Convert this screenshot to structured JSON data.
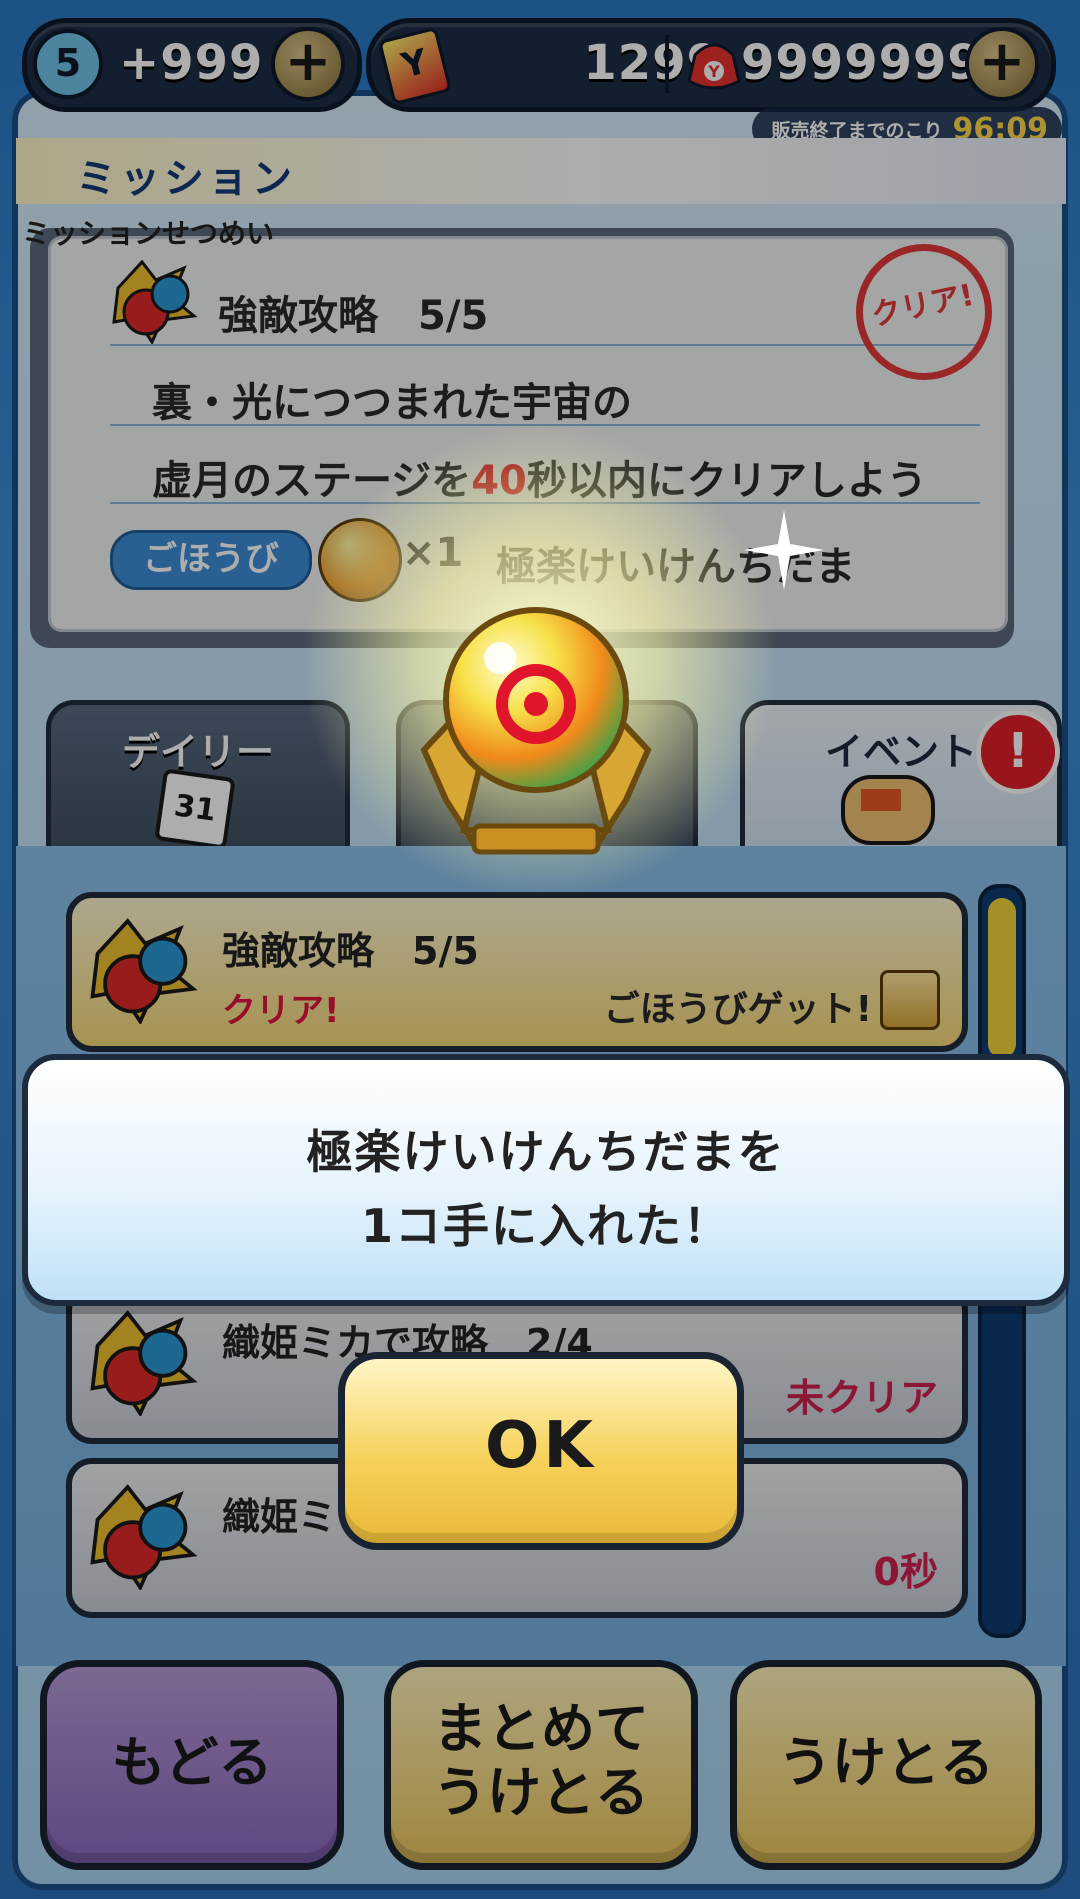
{
  "topbar": {
    "lives_count": "5",
    "lives_value": "+999",
    "tickets": "1299",
    "money": "9999999",
    "sale_label": "販売終了までのこり",
    "sale_timer": "96:09"
  },
  "mission_header": {
    "title": "ミッション"
  },
  "description": {
    "section_label": "ミッションせつめい",
    "mission_name": "強敵攻略　5/5",
    "line1": "裏・光につつまれた宇宙の",
    "line2_pre": "虚月のステージを",
    "line2_num": "40",
    "line2_post": "秒以内にクリアしよう",
    "reward_label": "ごほうび",
    "reward_qty": "×1",
    "reward_name": "極楽けいけんちだま",
    "clear_stamp": "クリア!"
  },
  "tabs": [
    {
      "label": "デイリー",
      "icon": "calendar-icon",
      "icon_text": "31"
    },
    {
      "label": "",
      "icon": ""
    },
    {
      "label": "イベント",
      "icon": "flag-icon"
    }
  ],
  "alert_badge": "!",
  "missions": [
    {
      "name": "強敵攻略　5/5",
      "clear": "クリア!",
      "get": "ごほうびゲット!"
    },
    {
      "name": "織姫ミカで攻略　2/4",
      "status": "未クリア"
    },
    {
      "name": "織姫ミ",
      "status": "0秒"
    }
  ],
  "dialog": {
    "line1": "極楽けいけんちだまを",
    "line2": "1コ手に入れた！",
    "ok": "OK"
  },
  "buttons": {
    "back": "もどる",
    "collect_all": "まとめて\nうけとる",
    "collect": "うけとる"
  },
  "colors": {
    "accent_red": "#e0141e",
    "button_gold": "#f6d15a",
    "back_purple": "#8b6ac0"
  }
}
